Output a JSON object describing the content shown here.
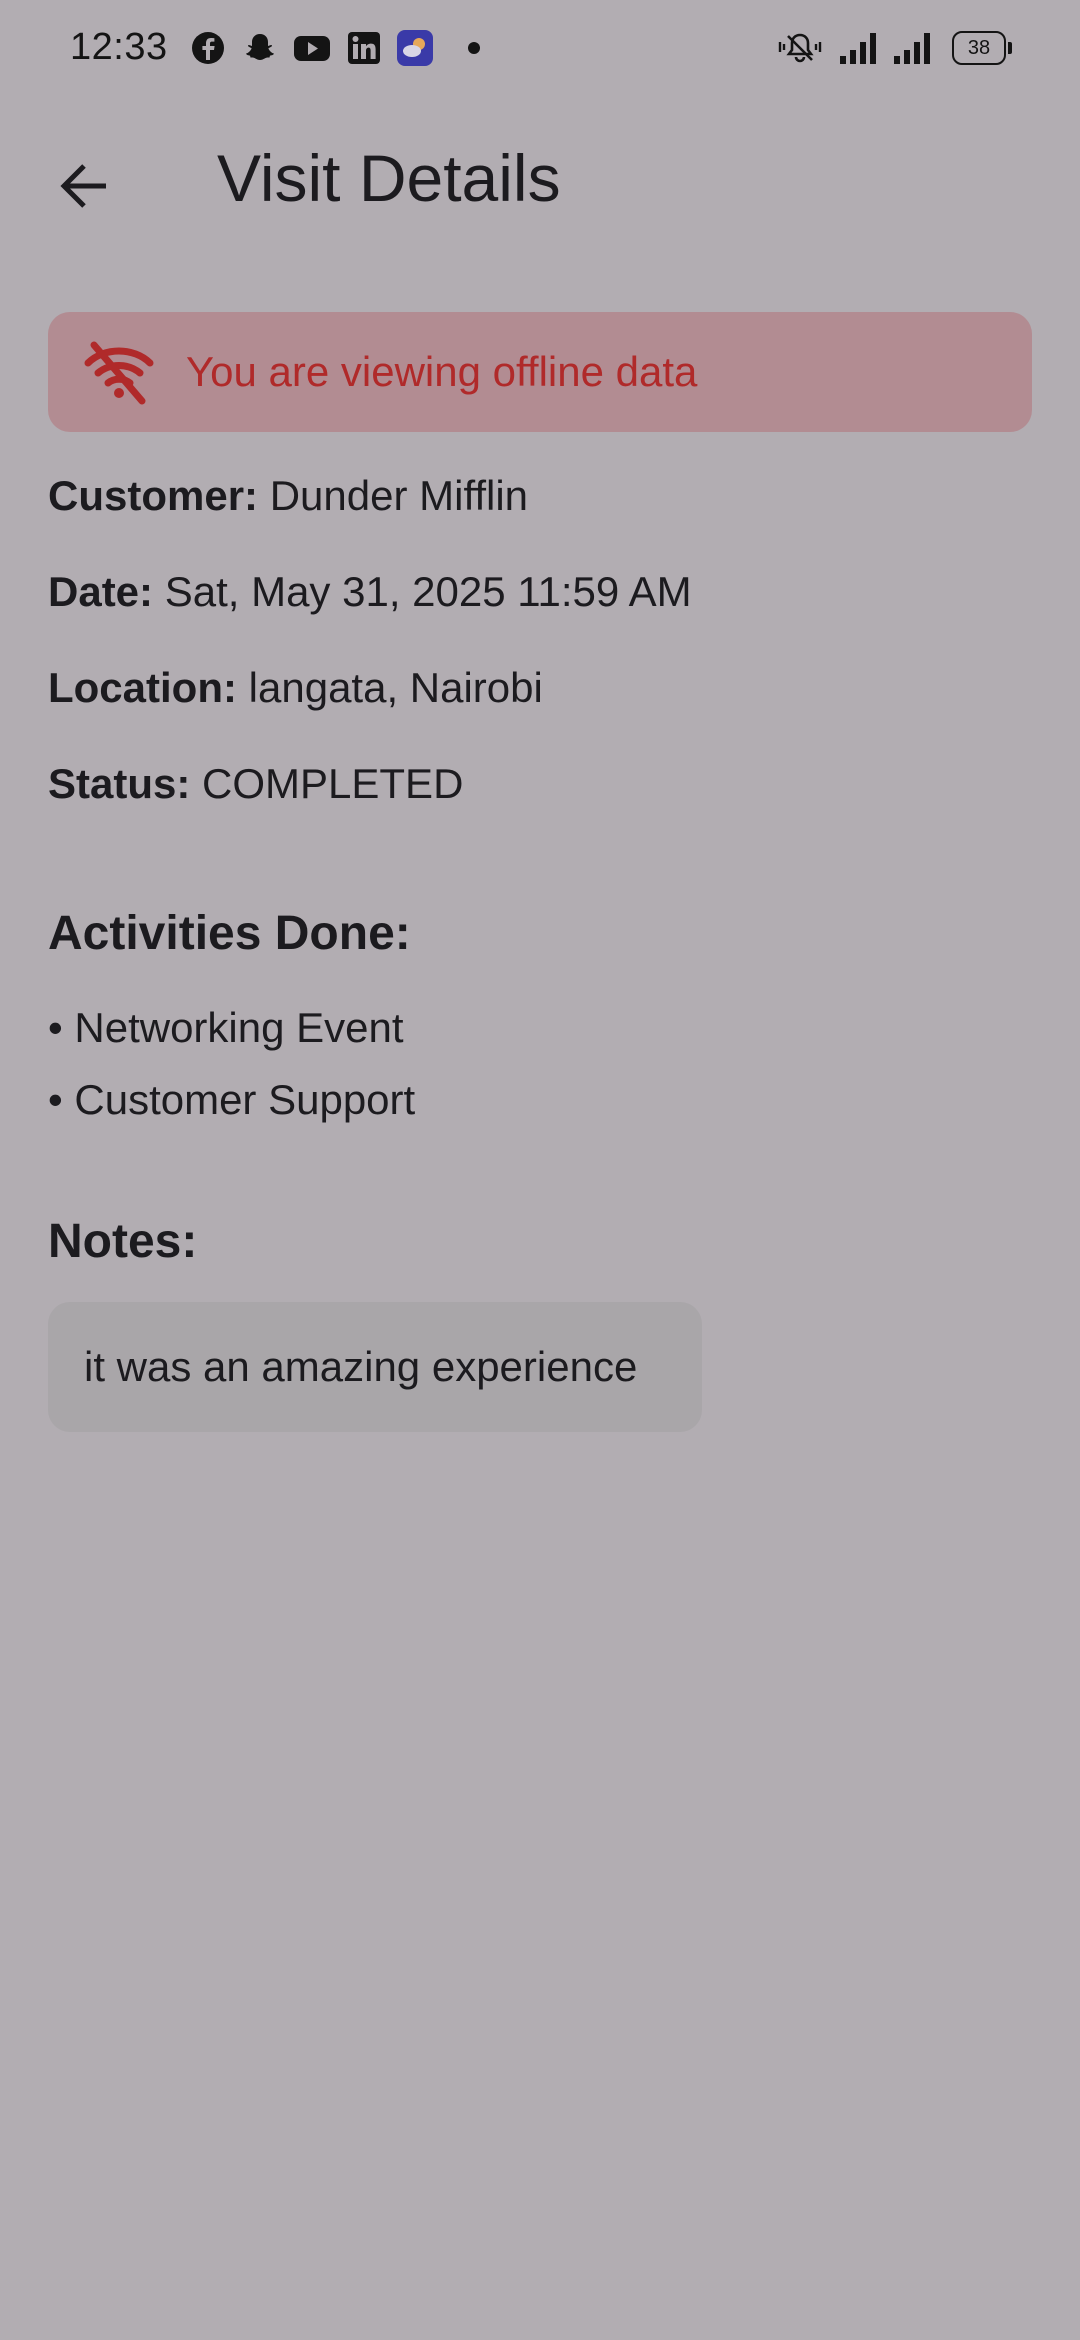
{
  "status_bar": {
    "time": "12:33",
    "battery": "38",
    "notification_icons": [
      "facebook-icon",
      "snapchat-icon",
      "youtube-icon",
      "linkedin-icon",
      "weather-icon",
      "dot-icon"
    ],
    "system_icons": [
      "mute-bell-icon",
      "signal-icon",
      "signal-icon"
    ]
  },
  "app_bar": {
    "title": "Visit Details",
    "back_icon": "arrow-back-icon"
  },
  "offline_banner": {
    "message": "You are viewing offline data",
    "icon": "wifi-off-icon",
    "color": "#b02a2a"
  },
  "details": {
    "customer_label": "Customer:",
    "customer_value": "Dunder Mifflin",
    "date_label": "Date:",
    "date_value": "Sat, May 31, 2025 11:59 AM",
    "location_label": "Location:",
    "location_value": "langata, Nairobi",
    "status_label": "Status:",
    "status_value": "COMPLETED"
  },
  "activities": {
    "heading": "Activities Done:",
    "items": [
      "• Networking Event",
      "• Customer Support"
    ]
  },
  "notes": {
    "heading": "Notes:",
    "text": "it was an amazing experience"
  },
  "colors": {
    "background": "#b2adb2",
    "banner_bg": "#b28c92",
    "notes_bg": "#a9a6a9"
  }
}
